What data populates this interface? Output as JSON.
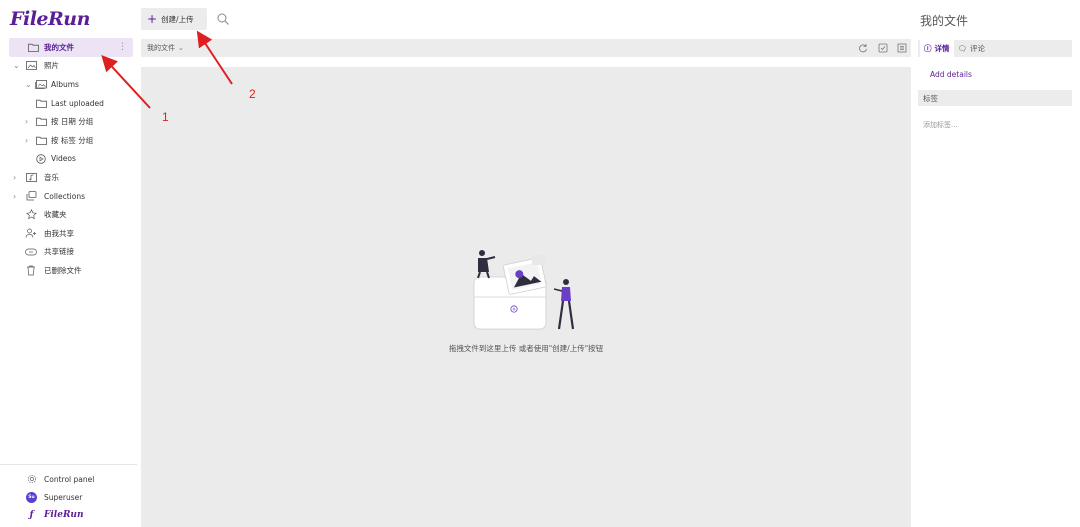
{
  "app": {
    "logo_text": "FileRun"
  },
  "sidebar": {
    "items": [
      {
        "label": "我的文件",
        "icon": "folder-icon",
        "active": true
      },
      {
        "label": "照片",
        "icon": "image-folder-icon"
      },
      {
        "label": "Albums",
        "icon": "album-icon"
      },
      {
        "label": "Last uploaded",
        "icon": "folder-icon"
      },
      {
        "label": "按 日期 分组",
        "icon": "folder-icon"
      },
      {
        "label": "按 标签 分组",
        "icon": "folder-icon"
      },
      {
        "label": "Videos",
        "icon": "play-circle-icon"
      },
      {
        "label": "音乐",
        "icon": "music-folder-icon"
      },
      {
        "label": "Collections",
        "icon": "collections-icon"
      },
      {
        "label": "收藏夹",
        "icon": "star-icon"
      },
      {
        "label": "由我共享",
        "icon": "user-share-icon"
      },
      {
        "label": "共享链接",
        "icon": "link-icon"
      },
      {
        "label": "已删除文件",
        "icon": "trash-icon"
      }
    ],
    "bottom": {
      "control_panel": "Control panel",
      "user": "Superuser",
      "avatar_initials": "Su",
      "mini_logo": "FileRun"
    }
  },
  "toolbar": {
    "create_upload_label": "创建/上传"
  },
  "breadcrumb": {
    "current": "我的文件"
  },
  "main": {
    "empty_message": "拖拽文件到这里上传 或者使用\"创建/上传\"按钮"
  },
  "details_panel": {
    "title": "我的文件",
    "tabs": [
      {
        "label": "详情",
        "icon": "info-icon"
      },
      {
        "label": "评论",
        "icon": "comments-icon"
      }
    ],
    "add_details": "Add details",
    "tags_header": "标签",
    "tags_placeholder": "添加标签..."
  },
  "annotations": {
    "marker_1": "1",
    "marker_2": "2"
  },
  "colors": {
    "accent": "#5a1e96",
    "annotation_red": "#e02020",
    "main_bg": "#ebebeb"
  }
}
